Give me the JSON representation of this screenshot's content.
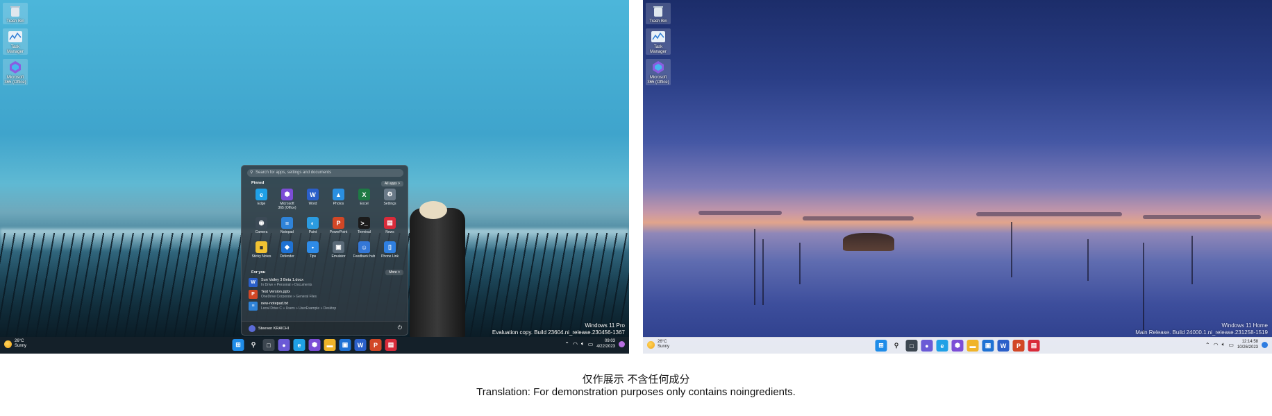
{
  "left_desktop": {
    "desktop_icons": [
      {
        "label": "Trash Bin",
        "icon": "trash-bin-icon"
      },
      {
        "label": "Task\nManager",
        "icon": "task-manager-icon"
      },
      {
        "label": "Microsoft\n365 (Office)",
        "icon": "office-icon"
      }
    ],
    "watermark": {
      "line1": "Windows 11 Pro",
      "line2": "Evaluation copy. Build 23604.ni_release.230456-1367"
    },
    "start_menu": {
      "search_placeholder": "Search for apps, settings and documents",
      "pinned_heading": "Pinned",
      "all_apps_label": "All apps  >",
      "pinned": [
        {
          "label": "Edge",
          "icon": "edge-icon",
          "color": "#1fa0e6"
        },
        {
          "label": "Microsoft\n365 (Office)",
          "icon": "office-icon",
          "color": "#7c4dd6"
        },
        {
          "label": "Word",
          "icon": "word-icon",
          "color": "#2b5fc9"
        },
        {
          "label": "Photos",
          "icon": "photos-icon",
          "color": "#2a8fe0"
        },
        {
          "label": "Excel",
          "icon": "excel-icon",
          "color": "#1e7a44"
        },
        {
          "label": "Settings",
          "icon": "gear-icon",
          "color": "#6a7a88"
        },
        {
          "label": "Camera",
          "icon": "camera-icon",
          "color": "#3c4a56"
        },
        {
          "label": "Notepad",
          "icon": "notepad-icon",
          "color": "#2f83d8"
        },
        {
          "label": "Paint",
          "icon": "paint-icon",
          "color": "#2b9be0"
        },
        {
          "label": "PowerPoint",
          "icon": "powerpoint-icon",
          "color": "#d24726"
        },
        {
          "label": "Terminal",
          "icon": "terminal-icon",
          "color": "#1b1b1b"
        },
        {
          "label": "News",
          "icon": "news-icon",
          "color": "#d92b3a"
        },
        {
          "label": "Sticky Notes",
          "icon": "sticky-notes-icon",
          "color": "#f1c232"
        },
        {
          "label": "Defender",
          "icon": "defender-icon",
          "color": "#1f72d4"
        },
        {
          "label": "Tips",
          "icon": "tips-icon",
          "color": "#2e8be8"
        },
        {
          "label": "Emulator",
          "icon": "emulator-icon",
          "color": "#5a6a78"
        },
        {
          "label": "Feedback hub",
          "icon": "feedback-hub-icon",
          "color": "#3477d6"
        },
        {
          "label": "Phone Link",
          "icon": "phone-link-icon",
          "color": "#2f7fe0"
        }
      ],
      "for_you_heading": "For you",
      "more_label": "More  >",
      "recommended": [
        {
          "title": "Sun Valley 3 Beta 1.docx",
          "sub": "In Drive » Personal » Documents",
          "icon": "word-icon",
          "color": "#2b5fc9"
        },
        {
          "title": "Test Version.pptx",
          "sub": "OneDrive Corporate » General Files",
          "icon": "powerpoint-icon",
          "color": "#d24726"
        },
        {
          "title": "new-notepad.txt",
          "sub": "Local Drive C » Users » UserExample » Desktop",
          "icon": "notepad-icon",
          "color": "#2f83d8"
        }
      ],
      "user_name": "Steeven KRAICHI"
    },
    "taskbar": {
      "weather_temp": "26°C",
      "weather_cond": "Sunny",
      "apps": [
        {
          "icon": "windows-start-icon",
          "color": "#1f8ce8"
        },
        {
          "icon": "search-icon",
          "color": "transparent"
        },
        {
          "icon": "task-view-icon",
          "color": "#3c4650"
        },
        {
          "icon": "chat-icon",
          "color": "#6a5ad6"
        },
        {
          "icon": "edge-icon",
          "color": "#1fa0e6"
        },
        {
          "icon": "office-icon",
          "color": "#7c4dd6"
        },
        {
          "icon": "file-explorer-icon",
          "color": "#f0b429"
        },
        {
          "icon": "store-icon",
          "color": "#1f72d4"
        },
        {
          "icon": "word-icon",
          "color": "#2b5fc9"
        },
        {
          "icon": "powerpoint-icon",
          "color": "#d24726"
        },
        {
          "icon": "news-icon",
          "color": "#d92b3a"
        }
      ],
      "time": "09:03",
      "date": "4/22/2023"
    }
  },
  "right_desktop": {
    "desktop_icons": [
      {
        "label": "Trash Bin",
        "icon": "trash-bin-icon"
      },
      {
        "label": "Task\nManager",
        "icon": "task-manager-icon"
      },
      {
        "label": "Microsoft\n365 (Office)",
        "icon": "office-icon"
      }
    ],
    "watermark": {
      "line1": "Windows 11 Home",
      "line2": "Main Release. Build 24000.1.ni_release.231258-1519"
    },
    "taskbar": {
      "weather_temp": "26°C",
      "weather_cond": "Sunny",
      "apps": [
        {
          "icon": "windows-start-icon",
          "color": "#1f8ce8"
        },
        {
          "icon": "search-icon",
          "color": "transparent"
        },
        {
          "icon": "task-view-icon",
          "color": "#3c4650"
        },
        {
          "icon": "chat-icon",
          "color": "#6a5ad6"
        },
        {
          "icon": "edge-icon",
          "color": "#1fa0e6"
        },
        {
          "icon": "office-icon",
          "color": "#7c4dd6"
        },
        {
          "icon": "file-explorer-icon",
          "color": "#f0b429"
        },
        {
          "icon": "store-icon",
          "color": "#1f72d4"
        },
        {
          "icon": "word-icon",
          "color": "#2b5fc9"
        },
        {
          "icon": "powerpoint-icon",
          "color": "#d24726"
        },
        {
          "icon": "news-icon",
          "color": "#d92b3a"
        }
      ],
      "time": "12:14:58",
      "date": "10/26/2023"
    }
  },
  "caption": {
    "chinese": "仅作展示 不含任何成分",
    "english": "Translation: For demonstration purposes only contains noingredients."
  }
}
